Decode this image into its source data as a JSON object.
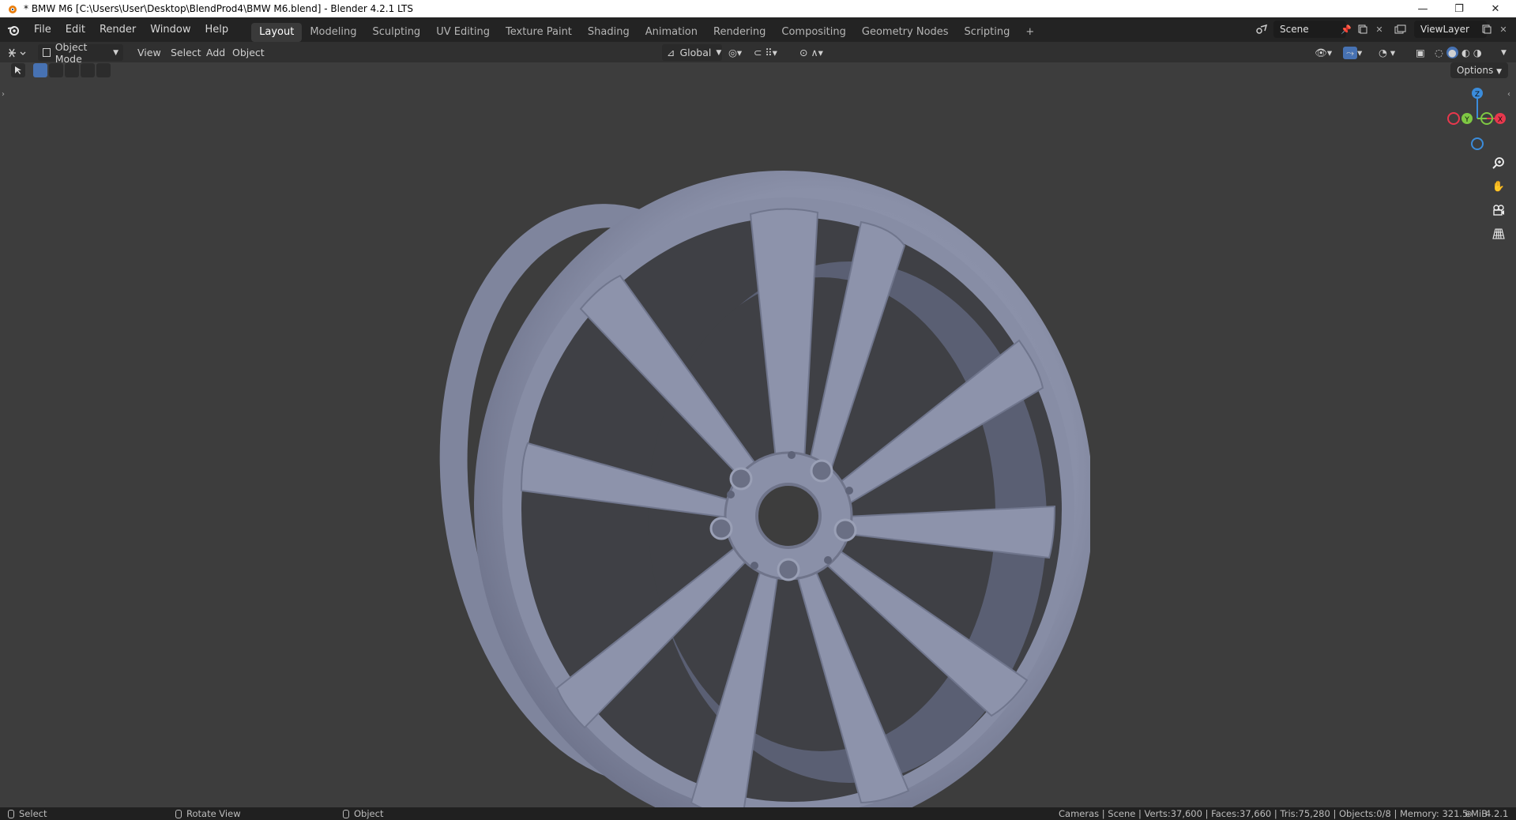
{
  "window": {
    "title": "* BMW M6 [C:\\Users\\User\\Desktop\\BlendProd4\\BMW M6.blend] - Blender 4.2.1 LTS",
    "minimize": "—",
    "maximize": "❐",
    "close": "✕"
  },
  "topbar": {
    "menus": [
      "File",
      "Edit",
      "Render",
      "Window",
      "Help"
    ],
    "workspaces": [
      "Layout",
      "Modeling",
      "Sculpting",
      "UV Editing",
      "Texture Paint",
      "Shading",
      "Animation",
      "Rendering",
      "Compositing",
      "Geometry Nodes",
      "Scripting"
    ],
    "active_workspace": "Layout",
    "add_workspace": "+",
    "scene": "Scene",
    "view_layer": "ViewLayer"
  },
  "viewport_header": {
    "mode": "Object Mode",
    "menus": [
      "View",
      "Select",
      "Add",
      "Object"
    ],
    "orientation": "Global",
    "options": "Options"
  },
  "gizmo": {
    "z": "Z",
    "y": "Y",
    "x": "X",
    "colors": {
      "x": "#e8384d",
      "y": "#7ec843",
      "z": "#3b8cdb"
    }
  },
  "status": {
    "left": [
      "Select",
      "Rotate View",
      "Object"
    ],
    "stats": "Cameras | Scene | Verts:37,600 | Faces:37,660 | Tris:75,280 | Objects:0/8 | Memory: 321.5 MiB",
    "version": "4.2.1"
  },
  "colors": {
    "viewport_bg": "#3d3d3d",
    "wheel": "#8a90a8",
    "header": "#303030",
    "topbar": "#232323"
  }
}
